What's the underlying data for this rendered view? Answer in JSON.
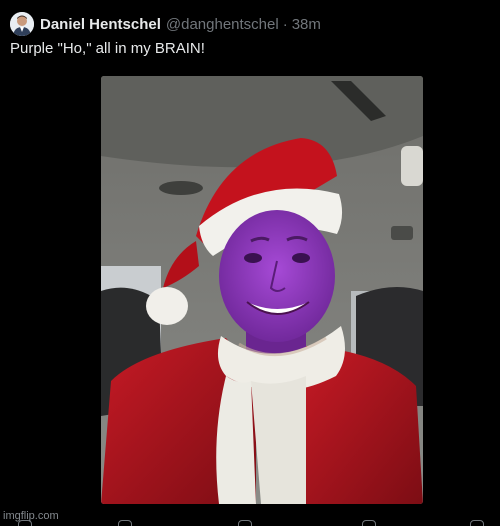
{
  "post": {
    "display_name": "Daniel Hentschel",
    "handle": "@danghentschel",
    "separator": "·",
    "time": "38m",
    "text": "Purple \"Ho,\" all in my BRAIN!"
  },
  "watermark": "imgflip.com",
  "icons": [
    "avatar-image",
    "reply-icon",
    "repost-icon",
    "like-icon",
    "views-icon",
    "share-icon"
  ],
  "colors": {
    "background": "#000000",
    "primary_text": "#e7e9ea",
    "secondary_text": "#71767b"
  }
}
